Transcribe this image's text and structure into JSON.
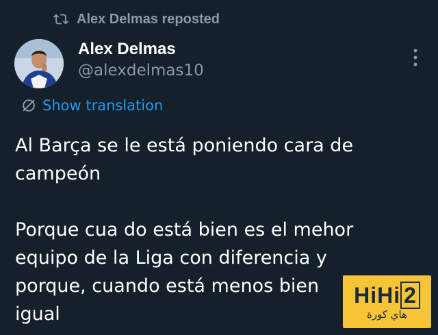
{
  "repost": {
    "label": "Alex Delmas reposted",
    "icon": "repost-icon"
  },
  "author": {
    "name": "Alex Delmas",
    "handle": "@alexdelmas10",
    "avatar": "avatar-photo"
  },
  "menu": {
    "icon": "more-vertical-icon"
  },
  "translation": {
    "label": "Show translation",
    "icon": "translate-icon"
  },
  "tweet": {
    "text": "Al Barça se le está poniendo cara de\ncampeón\n\nPorque cua do está bien es el mehor\nequipo de la Liga con diferencia y\nporque, cuando está menos bien\nigual"
  },
  "watermark": {
    "logo_main": "HiHi",
    "logo_box": "2",
    "subtitle": "هاي كورة"
  },
  "colors": {
    "background": "#15202b",
    "muted": "#8b98a5",
    "link": "#1d9bf0",
    "watermark_bg": "#f6c436"
  }
}
